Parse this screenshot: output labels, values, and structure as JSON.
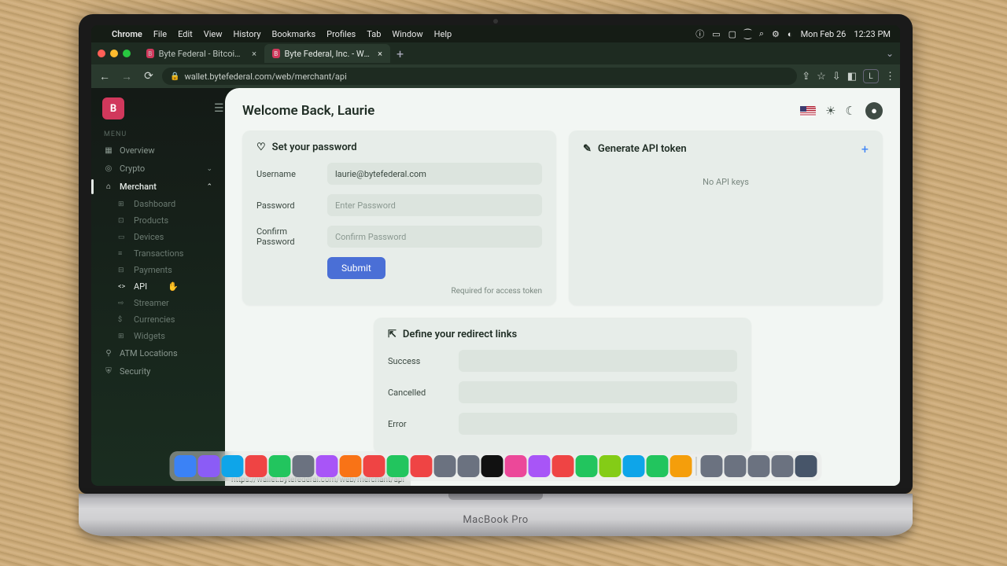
{
  "menubar": {
    "app": "Chrome",
    "items": [
      "File",
      "Edit",
      "View",
      "History",
      "Bookmarks",
      "Profiles",
      "Tab",
      "Window",
      "Help"
    ],
    "date": "Mon Feb 26",
    "time": "12:23 PM"
  },
  "tabs": [
    {
      "title": "Byte Federal - Bitcoin ATMs,",
      "active": false
    },
    {
      "title": "Byte Federal, Inc. - Web Wall",
      "active": true
    }
  ],
  "url": "wallet.bytefederal.com/web/merchant/api",
  "status_url": "https://wallet.bytefederal.com/web/merchant/api",
  "sidebar": {
    "menu_label": "MENU",
    "items": [
      {
        "icon": "grid",
        "label": "Overview"
      },
      {
        "icon": "coin",
        "label": "Crypto",
        "chev": true
      },
      {
        "icon": "store",
        "label": "Merchant",
        "chev": true,
        "active": true,
        "children": [
          {
            "label": "Dashboard"
          },
          {
            "label": "Products"
          },
          {
            "label": "Devices"
          },
          {
            "label": "Transactions"
          },
          {
            "label": "Payments"
          },
          {
            "label": "API",
            "active": true
          },
          {
            "label": "Streamer"
          },
          {
            "label": "Currencies"
          },
          {
            "label": "Widgets"
          }
        ]
      },
      {
        "icon": "pin",
        "label": "ATM Locations"
      },
      {
        "icon": "shield",
        "label": "Security"
      }
    ]
  },
  "header": {
    "welcome": "Welcome Back, Laurie"
  },
  "password_card": {
    "title": "Set your password",
    "username_label": "Username",
    "username_value": "laurie@bytefederal.com",
    "password_label": "Password",
    "password_placeholder": "Enter Password",
    "confirm_label": "Confirm Password",
    "confirm_placeholder": "Confirm Password",
    "submit": "Submit",
    "note": "Required for access token"
  },
  "api_card": {
    "title": "Generate API token",
    "empty": "No API keys"
  },
  "redirect_card": {
    "title": "Define your redirect links",
    "success": "Success",
    "cancelled": "Cancelled",
    "error": "Error"
  },
  "laptop_model": "MacBook Pro",
  "dock_colors": [
    "#3b82f6",
    "#8b5cf6",
    "#0ea5e9",
    "#ef4444",
    "#22c55e",
    "#6b7280",
    "#a855f7",
    "#f97316",
    "#ef4444",
    "#22c55e",
    "#ef4444",
    "#6b7280",
    "#6b7280",
    "#111",
    "#ec4899",
    "#a855f7",
    "#ef4444",
    "#22c55e",
    "#84cc16",
    "#0ea5e9",
    "#22c55e",
    "#f59e0b",
    "#6b7280",
    "#6b7280",
    "#6b7280",
    "#6b7280",
    "#475569"
  ]
}
